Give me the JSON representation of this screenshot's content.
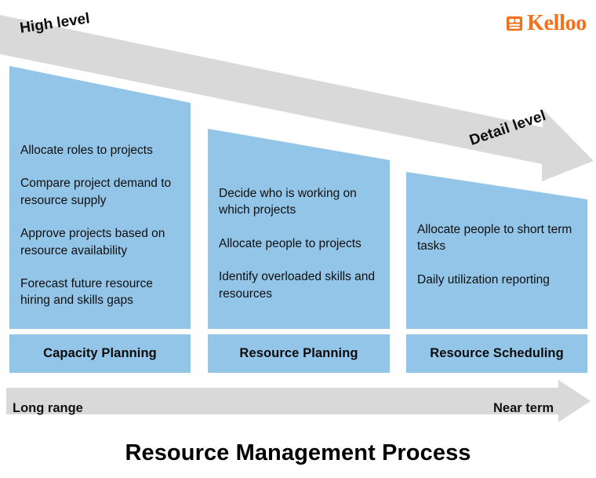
{
  "brand": {
    "name": "Kelloo",
    "logo_icon": "document-list-icon",
    "color": "#F4701A"
  },
  "top_arrow": {
    "start_label": "High level",
    "end_label": "Detail  level",
    "color": "#D9D9D9"
  },
  "bottom_arrow": {
    "start_label": "Long range",
    "end_label": "Near term",
    "color": "#D9D9D9"
  },
  "title": "Resource Management Process",
  "panel_color": "#93C5E8",
  "columns": [
    {
      "header": "Capacity Planning",
      "items": [
        "Allocate roles to projects",
        "Compare project demand to resource supply",
        "Approve projects based on resource availability",
        "Forecast future resource hiring and skills gaps"
      ]
    },
    {
      "header": "Resource Planning",
      "items": [
        "Decide who is working on which projects",
        "Allocate people to projects",
        "Identify overloaded skills and resources"
      ]
    },
    {
      "header": "Resource Scheduling",
      "items": [
        "Allocate people to short term tasks",
        "Daily utilization reporting"
      ]
    }
  ]
}
